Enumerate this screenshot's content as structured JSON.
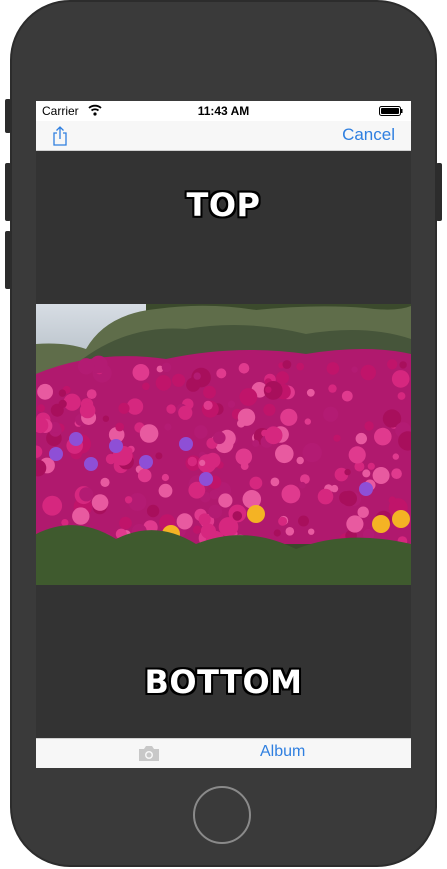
{
  "status_bar": {
    "carrier": "Carrier",
    "time": "11:43 AM",
    "wifi_icon": "wifi-icon",
    "battery_icon": "battery-icon"
  },
  "nav_bar": {
    "share_icon": "share-icon",
    "cancel_label": "Cancel"
  },
  "meme": {
    "top_text": "TOP",
    "bottom_text": "BOTTOM"
  },
  "toolbar": {
    "camera_icon": "camera-icon",
    "album_label": "Album"
  },
  "colors": {
    "accent": "#2f7fe0",
    "canvas": "#333333",
    "device": "#3a3a3a"
  }
}
